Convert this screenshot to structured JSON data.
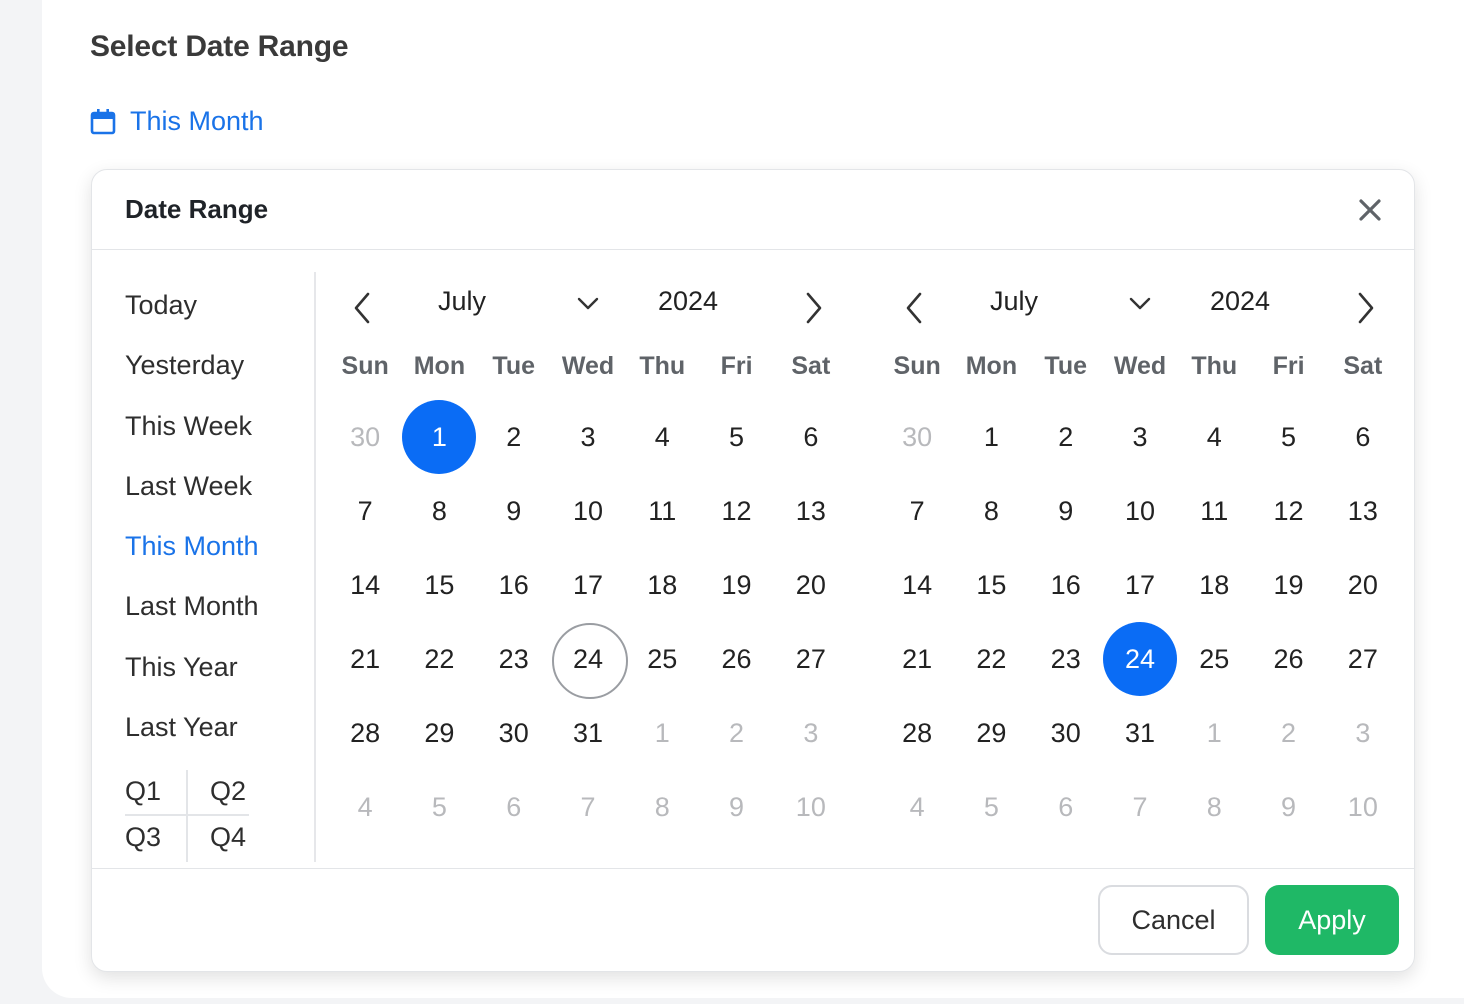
{
  "page": {
    "title": "Select Date Range"
  },
  "trigger": {
    "label": "This Month",
    "icon": "calendar-icon",
    "color": "#1a73e8"
  },
  "popover": {
    "title": "Date Range",
    "presets": [
      "Today",
      "Yesterday",
      "This Week",
      "Last Week",
      "This Month",
      "Last Month",
      "This Year",
      "Last Year"
    ],
    "active_preset": "This Month",
    "quarters": [
      "Q1",
      "Q2",
      "Q3",
      "Q4"
    ],
    "weekdays": [
      "Sun",
      "Mon",
      "Tue",
      "Wed",
      "Thu",
      "Fri",
      "Sat"
    ],
    "calendars": [
      {
        "month": "July",
        "year": "2024",
        "weeks": [
          [
            "30",
            "1",
            "2",
            "3",
            "4",
            "5",
            "6"
          ],
          [
            "7",
            "8",
            "9",
            "10",
            "11",
            "12",
            "13"
          ],
          [
            "14",
            "15",
            "16",
            "17",
            "18",
            "19",
            "20"
          ],
          [
            "21",
            "22",
            "23",
            "24",
            "25",
            "26",
            "27"
          ],
          [
            "28",
            "29",
            "30",
            "31",
            "1",
            "2",
            "3"
          ],
          [
            "4",
            "5",
            "6",
            "7",
            "8",
            "9",
            "10"
          ]
        ],
        "selected_day": "1",
        "today_day": "24"
      },
      {
        "month": "July",
        "year": "2024",
        "weeks": [
          [
            "30",
            "1",
            "2",
            "3",
            "4",
            "5",
            "6"
          ],
          [
            "7",
            "8",
            "9",
            "10",
            "11",
            "12",
            "13"
          ],
          [
            "14",
            "15",
            "16",
            "17",
            "18",
            "19",
            "20"
          ],
          [
            "21",
            "22",
            "23",
            "24",
            "25",
            "26",
            "27"
          ],
          [
            "28",
            "29",
            "30",
            "31",
            "1",
            "2",
            "3"
          ],
          [
            "4",
            "5",
            "6",
            "7",
            "8",
            "9",
            "10"
          ]
        ],
        "selected_day": "24",
        "today_day": ""
      }
    ],
    "cancel_label": "Cancel",
    "apply_label": "Apply",
    "colors": {
      "accent": "#0a6cf5",
      "apply": "#1fb866"
    }
  }
}
